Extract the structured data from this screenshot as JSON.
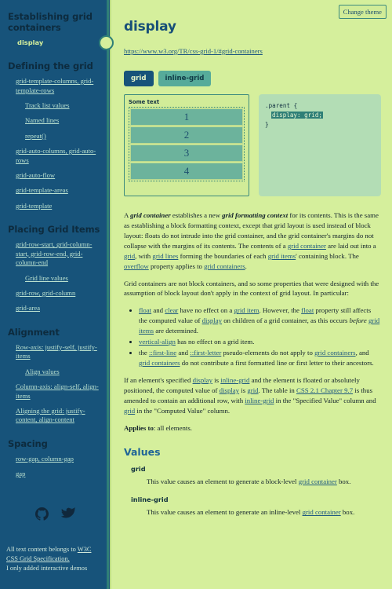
{
  "theme_button": "Change theme",
  "sidebar": {
    "sections": [
      {
        "heading": "Establishing grid containers",
        "items": [
          {
            "label": "display",
            "level": 1,
            "active": true
          }
        ]
      },
      {
        "heading": "Defining the grid",
        "items": [
          {
            "label": "grid-template-columns, grid-template-rows",
            "level": 1,
            "active": false
          },
          {
            "label": "Track list values",
            "level": 2,
            "active": false
          },
          {
            "label": "Named lines",
            "level": 2,
            "active": false
          },
          {
            "label": "repeat()",
            "level": 2,
            "active": false
          },
          {
            "label": "grid-auto-columns, grid-auto-rows",
            "level": 1,
            "active": false
          },
          {
            "label": "grid-auto-flow",
            "level": 1,
            "active": false
          },
          {
            "label": "grid-template-areas",
            "level": 1,
            "active": false
          },
          {
            "label": "grid-template",
            "level": 1,
            "active": false
          }
        ]
      },
      {
        "heading": "Placing Grid Items",
        "items": [
          {
            "label": "grid-row-start, grid-column-start, grid-row-end, grid-column-end",
            "level": 1,
            "active": false
          },
          {
            "label": "Grid line values",
            "level": 2,
            "active": false
          },
          {
            "label": "grid-row, grid-column",
            "level": 1,
            "active": false
          },
          {
            "label": "grid-area",
            "level": 1,
            "active": false
          }
        ]
      },
      {
        "heading": "Alignment",
        "items": [
          {
            "label": "Row-axis: justify-self, justify-items",
            "level": 1,
            "active": false
          },
          {
            "label": "Align values",
            "level": 2,
            "active": false
          },
          {
            "label": "Column-axis: align-self, align-items",
            "level": 1,
            "active": false
          },
          {
            "label": "Aligning the grid: justify-content, align-content",
            "level": 1,
            "active": false
          }
        ]
      },
      {
        "heading": "Spacing",
        "items": [
          {
            "label": "row-gap, column-gap",
            "level": 1,
            "active": false
          },
          {
            "label": "gap",
            "level": 1,
            "active": false
          }
        ]
      }
    ],
    "social": [
      {
        "name": "github-icon",
        "label": "GitHub"
      },
      {
        "name": "twitter-icon",
        "label": "Twitter"
      }
    ],
    "footnote_pre": "All text content belongs to ",
    "footnote_link": "W3C CSS Grid Specification.",
    "footnote_post": "I only added interactive demos"
  },
  "main": {
    "title": "display",
    "spec_url": "https://www.w3.org/TR/css-grid-1/#grid-containers",
    "tabs": [
      {
        "label": "grid",
        "active": true
      },
      {
        "label": "inline-grid",
        "active": false
      }
    ],
    "demo": {
      "label": "Some text",
      "cells": [
        "1",
        "2",
        "3",
        "4"
      ],
      "code_selector": ".parent {",
      "code_declaration": "display: grid;",
      "code_close": "}"
    },
    "paragraphs": {
      "p1": "A grid container establishes a new grid formatting context for its contents. This is the same as establishing a block formatting context, except that grid layout is used instead of block layout: floats do not intrude into the grid container, and the grid container's margins do not collapse with the margins of its contents. The contents of a grid container are laid out into a grid, with grid lines forming the boundaries of each grid items' containing block. The overflow property applies to grid containers.",
      "p2": "Grid containers are not block containers, and so some properties that were designed with the assumption of block layout don't apply in the context of grid layout. In particular:",
      "bullets": [
        "float and clear have no effect on a grid item. However, the float property still affects the computed value of display on children of a grid container, as this occurs before grid items are determined.",
        "vertical-align has no effect on a grid item.",
        "the ::first-line and ::first-letter pseudo-elements do not apply to grid containers, and grid containers do not contribute a first formatted line or first letter to their ancestors."
      ],
      "p3": "If an element's specified display is inline-grid and the element is floated or absolutely positioned, the computed value of display is grid. The table in CSS 2.1 Chapter 9.7 is thus amended to contain an additional row, with inline-grid in the \"Specified Value\" column and grid in the \"Computed Value\" column.",
      "applies_to_label": "Applies to",
      "applies_to_value": ": all elements."
    },
    "values_heading": "Values",
    "values": [
      {
        "term": "grid",
        "definition": "This value causes an element to generate a block-level grid container box."
      },
      {
        "term": "inline-grid",
        "definition": "This value causes an element to generate an inline-level grid container box."
      }
    ]
  },
  "colors": {
    "sidebar_bg": "#17537a",
    "main_bg": "#d5ef9c",
    "accent_teal": "#2f7f77",
    "link_blue": "#1f5a80",
    "tab_active_bg": "#17537a",
    "tab_inactive_bg": "#56ab9a",
    "code_bg": "#b3ddb5",
    "cell_bg": "#6cb39c"
  }
}
